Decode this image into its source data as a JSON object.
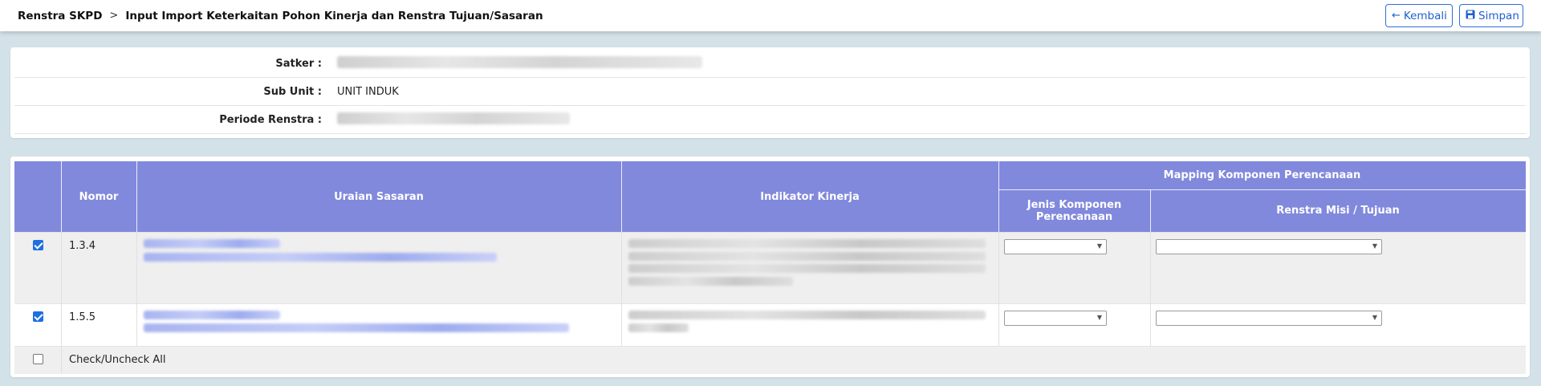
{
  "breadcrumb": {
    "root": "Renstra SKPD",
    "separator": ">",
    "current": "Input Import Keterkaitan Pohon Kinerja dan Renstra Tujuan/Sasaran"
  },
  "actions": {
    "back_label": "Kembali",
    "save_label": "Simpan"
  },
  "info": {
    "satker_label": "Satker :",
    "subunit_label": "Sub Unit :",
    "subunit_value": "UNIT INDUK",
    "periode_label": "Periode Renstra :"
  },
  "table": {
    "headers": {
      "nomor": "Nomor",
      "uraian": "Uraian Sasaran",
      "indikator": "Indikator Kinerja",
      "mapping": "Mapping Komponen Perencanaan",
      "jenis": "Jenis Komponen Perencanaan",
      "misi": "Renstra Misi / Tujuan"
    },
    "rows": [
      {
        "checked": true,
        "nomor": "1.3.4"
      },
      {
        "checked": true,
        "nomor": "1.5.5"
      }
    ],
    "check_all_label": "Check/Uncheck All"
  },
  "colors": {
    "header_bg": "#8189dc",
    "accent": "#1f6fe0",
    "page_bg": "#d3e2e8"
  }
}
